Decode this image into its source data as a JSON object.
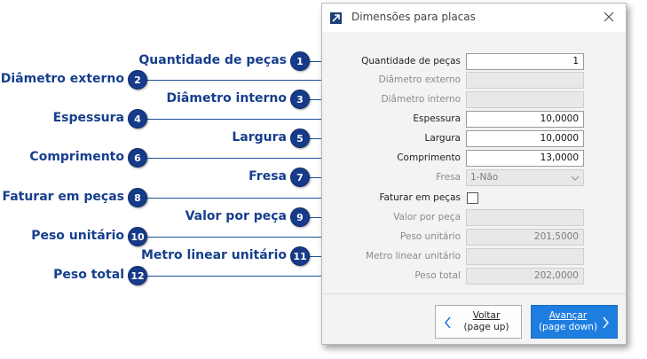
{
  "dialog": {
    "title": "Dimensões para placas",
    "fields": [
      {
        "label": "Quantidade de peças",
        "value": "1",
        "enabled": true
      },
      {
        "label": "Diâmetro externo",
        "value": "",
        "enabled": false
      },
      {
        "label": "Diâmetro interno",
        "value": "",
        "enabled": false
      },
      {
        "label": "Espessura",
        "value": "10,0000",
        "enabled": true
      },
      {
        "label": "Largura",
        "value": "10,0000",
        "enabled": true
      },
      {
        "label": "Comprimento",
        "value": "13,0000",
        "enabled": true
      },
      {
        "label": "Fresa",
        "value": "1-Não",
        "enabled": false
      },
      {
        "label": "Faturar em peças",
        "value": "",
        "enabled": true
      },
      {
        "label": "Valor por peça",
        "value": "",
        "enabled": false
      },
      {
        "label": "Peso unitário",
        "value": "201,5000",
        "enabled": false
      },
      {
        "label": "Metro linear unitário",
        "value": "",
        "enabled": false
      },
      {
        "label": "Peso total",
        "value": "202,0000",
        "enabled": false
      }
    ],
    "back_button": {
      "line1": "Voltar",
      "line2": "(page up)"
    },
    "next_button": {
      "line1": "Avançar",
      "line2": "(page down)"
    }
  },
  "callouts": [
    {
      "number": "1",
      "text": "Quantidade de peças"
    },
    {
      "number": "2",
      "text": "Diâmetro externo"
    },
    {
      "number": "3",
      "text": "Diâmetro interno"
    },
    {
      "number": "4",
      "text": "Espessura"
    },
    {
      "number": "5",
      "text": "Largura"
    },
    {
      "number": "6",
      "text": "Comprimento"
    },
    {
      "number": "7",
      "text": "Fresa"
    },
    {
      "number": "8",
      "text": "Faturar em peças"
    },
    {
      "number": "9",
      "text": "Valor por peça"
    },
    {
      "number": "10",
      "text": "Peso unitário"
    },
    {
      "number": "11",
      "text": "Metro linear unitário"
    },
    {
      "number": "12",
      "text": "Peso total"
    }
  ],
  "colors": {
    "callout_blue": "#153b8a",
    "accent_button": "#1e7ee0"
  },
  "icons": {
    "app": "expand-arrow-icon",
    "close": "close-icon",
    "dropdown": "chevron-down-icon",
    "back": "chevron-left-icon",
    "next": "chevron-right-icon"
  }
}
